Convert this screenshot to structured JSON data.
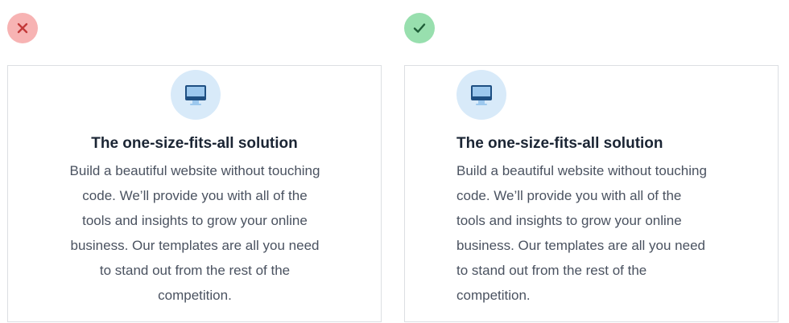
{
  "colors": {
    "bad_badge": "#f7b3b3",
    "bad_mark": "#c33a3a",
    "good_badge": "#98dfae",
    "good_mark": "#1f5e38",
    "icon_circle": "#d8eaf9",
    "title": "#1b2534",
    "body": "#4a5260"
  },
  "examples": {
    "bad": {
      "badge_icon": "close-icon",
      "feature_icon": "desktop-computer-icon",
      "title": "The one-size-fits-all solution",
      "body_lines": [
        "Build a beautiful website without touching",
        "code. We’ll provide you with all of the",
        "tools and insights to grow your online",
        "business. Our templates are all you need",
        "to stand out from the rest of the",
        "competition."
      ]
    },
    "good": {
      "badge_icon": "checkmark-icon",
      "feature_icon": "desktop-computer-icon",
      "title": "The one-size-fits-all solution",
      "body_lines": [
        "Build a beautiful website without touching",
        "code. We’ll provide you with all of the",
        "tools and insights to grow your online",
        "business. Our templates are all you need",
        "to stand out from the rest of the",
        "competition."
      ]
    }
  }
}
